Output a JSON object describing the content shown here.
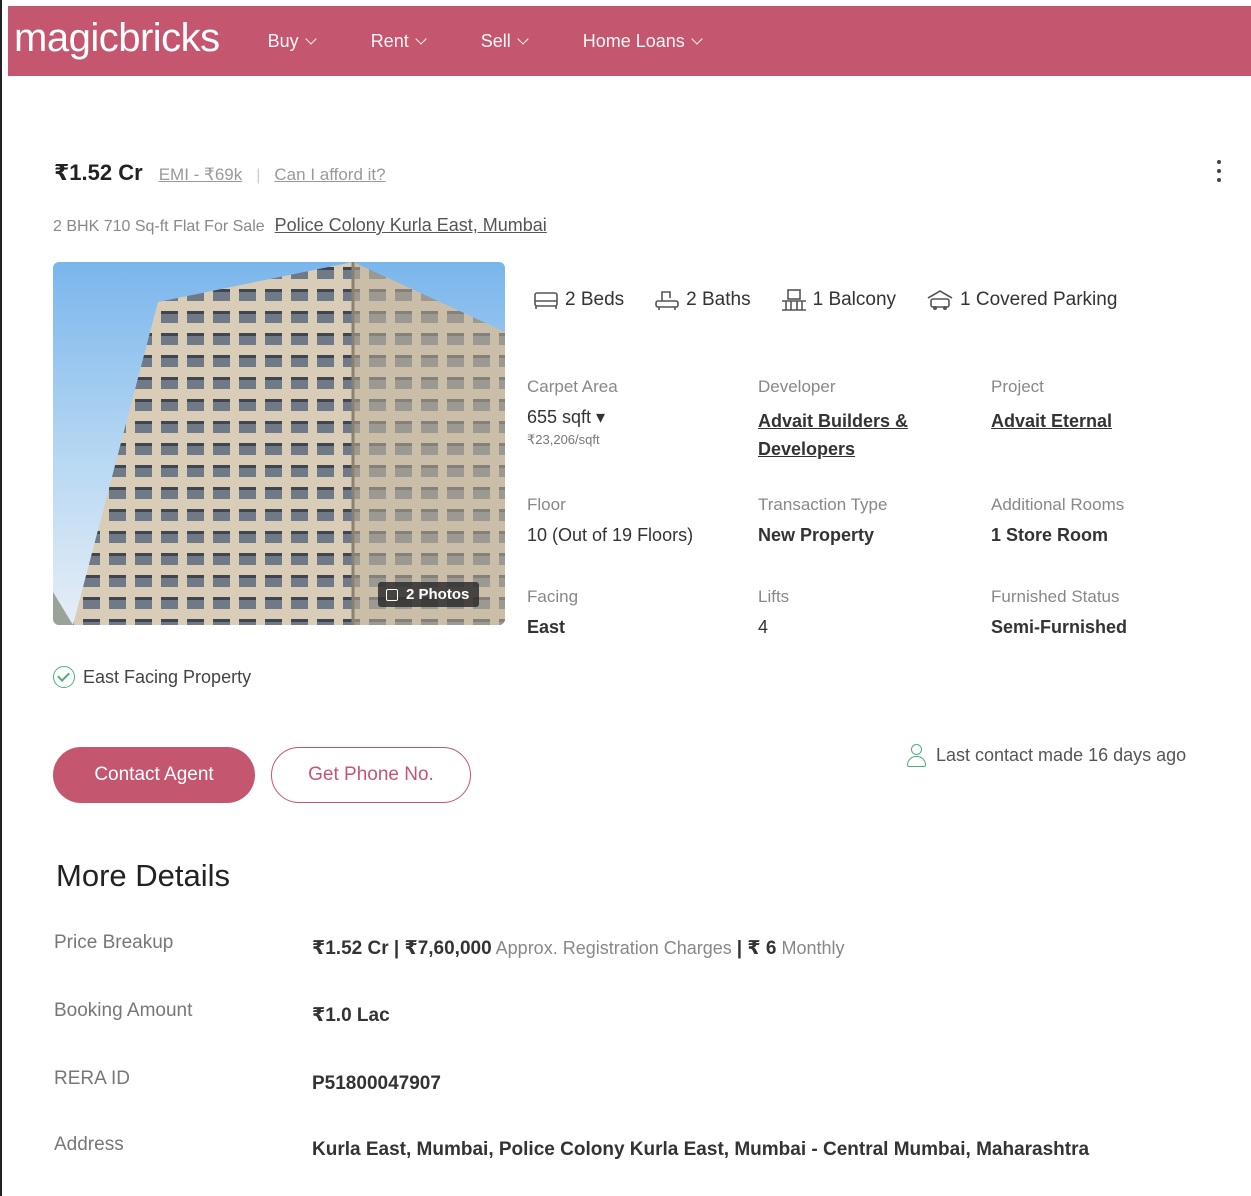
{
  "header": {
    "logo": "magicbricks",
    "nav": [
      {
        "label": "Buy"
      },
      {
        "label": "Rent"
      },
      {
        "label": "Sell"
      },
      {
        "label": "Home Loans"
      }
    ]
  },
  "listing": {
    "price": "₹1.52 Cr",
    "emi": "EMI - ₹69k",
    "separator": "|",
    "afford_link": "Can I afford it?",
    "title": "2 BHK 710 Sq-ft Flat For Sale",
    "locality": "Police Colony Kurla East, Mumbai",
    "photos_badge": "2 Photos",
    "amenities": [
      {
        "icon": "bed-icon",
        "label": "2 Beds"
      },
      {
        "icon": "bath-icon",
        "label": "2 Baths"
      },
      {
        "icon": "balcony-icon",
        "label": "1 Balcony"
      },
      {
        "icon": "car-icon",
        "label": "1 Covered Parking"
      }
    ],
    "attributes": {
      "carpet_area": {
        "label": "Carpet Area",
        "value": "655 sqft ▾",
        "sub": "₹23,206/sqft"
      },
      "developer": {
        "label": "Developer",
        "value": "Advait Builders & Developers"
      },
      "project": {
        "label": "Project",
        "value": "Advait Eternal"
      },
      "floor": {
        "label": "Floor",
        "value": "10 (Out of 19 Floors)"
      },
      "transaction": {
        "label": "Transaction Type",
        "value": "New Property"
      },
      "additional_rooms": {
        "label": "Additional Rooms",
        "value": "1 Store Room"
      },
      "facing": {
        "label": "Facing",
        "value": "East"
      },
      "lifts": {
        "label": "Lifts",
        "value": "4"
      },
      "furnished": {
        "label": "Furnished Status",
        "value": "Semi-Furnished"
      }
    },
    "facing_chip": "East Facing Property",
    "contact_button": "Contact Agent",
    "phone_button": "Get Phone No.",
    "last_contact": "Last contact made 16 days ago"
  },
  "more_details": {
    "title": "More Details",
    "rows": [
      {
        "key": "Price Breakup",
        "value_parts": [
          "₹1.52 Cr | ₹7,60,000",
          " Approx. Registration Charges ",
          "| ₹ 6",
          " Monthly"
        ]
      },
      {
        "key": "Booking Amount",
        "value": "₹1.0 Lac"
      },
      {
        "key": "RERA ID",
        "value": "P51800047907"
      },
      {
        "key": "Address",
        "value": "Kurla East, Mumbai, Police Colony Kurla East, Mumbai - Central Mumbai, Maharashtra"
      }
    ]
  },
  "colors": {
    "brand": "#c4566f",
    "success": "#4caf78"
  }
}
